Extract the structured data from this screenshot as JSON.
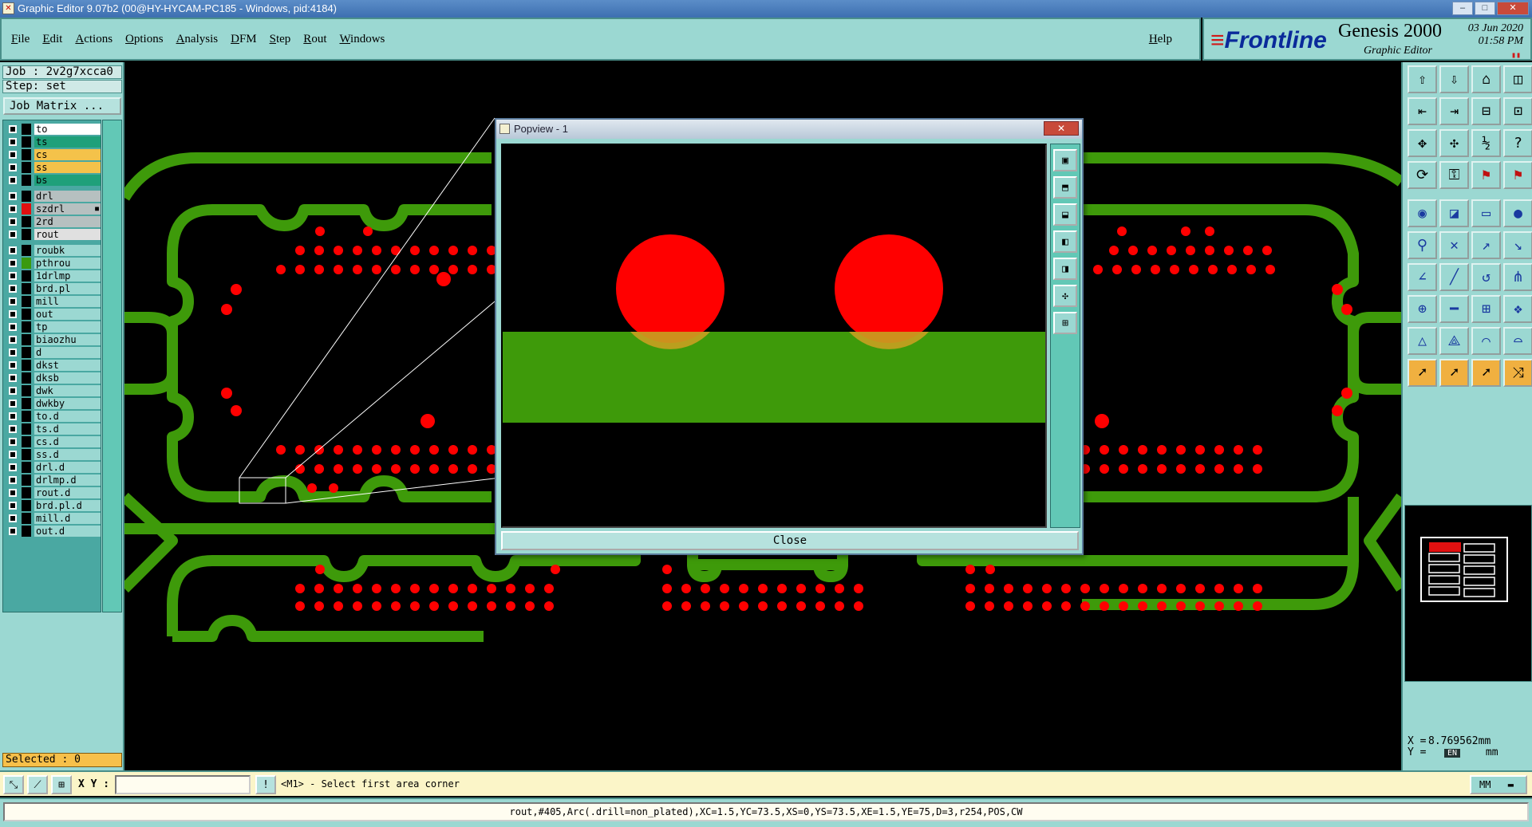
{
  "window": {
    "title": "Graphic Editor 9.07b2 (00@HY-HYCAM-PC185 - Windows, pid:4184)",
    "min": "–",
    "max": "□",
    "close": "✕"
  },
  "menu": [
    "File",
    "Edit",
    "Actions",
    "Options",
    "Analysis",
    "DFM",
    "Step",
    "Rout",
    "Windows"
  ],
  "help": "Help",
  "brand": {
    "logo": "Frontline",
    "product": "Genesis 2000",
    "subtitle": "Graphic Editor",
    "date": "03 Jun 2020",
    "time": "01:58 PM"
  },
  "job": {
    "job_line": "Job : 2v2g7xcca0",
    "step_line": "Step: set",
    "matrix_button": "Job Matrix ..."
  },
  "layers": [
    {
      "name": "to",
      "color": "#ffffff",
      "swatch": "#000000"
    },
    {
      "name": "ts",
      "color": "#1fa07a",
      "swatch": "#000000"
    },
    {
      "name": "cs",
      "color": "#f4c24a",
      "swatch": "#000000"
    },
    {
      "name": "ss",
      "color": "#f4c24a",
      "swatch": "#000000"
    },
    {
      "name": "bs",
      "color": "#1fa07a",
      "swatch": "#000000"
    },
    {
      "name": "drl",
      "color": "#b6c0c0",
      "swatch": "#000000"
    },
    {
      "name": "szdrl",
      "color": "#b6c0c0",
      "swatch": "#e01010",
      "marker": "■"
    },
    {
      "name": "2rd",
      "color": "#b6c0c0",
      "swatch": "#000000"
    },
    {
      "name": "rout",
      "color": "#e0e0e0",
      "swatch": "#000000"
    },
    {
      "name": "roubk",
      "color": "#9bd8d2",
      "swatch": "#000000"
    },
    {
      "name": "pthrou",
      "color": "#9bd8d2",
      "swatch": "#3a9a10"
    },
    {
      "name": "1drlmp",
      "color": "#9bd8d2",
      "swatch": "#000000"
    },
    {
      "name": "brd.pl",
      "color": "#9bd8d2",
      "swatch": "#000000"
    },
    {
      "name": "mill",
      "color": "#9bd8d2",
      "swatch": "#000000"
    },
    {
      "name": "out",
      "color": "#9bd8d2",
      "swatch": "#000000"
    },
    {
      "name": "tp",
      "color": "#9bd8d2",
      "swatch": "#000000"
    },
    {
      "name": "biaozhu",
      "color": "#9bd8d2",
      "swatch": "#000000"
    },
    {
      "name": "d",
      "color": "#9bd8d2",
      "swatch": "#000000"
    },
    {
      "name": "dkst",
      "color": "#9bd8d2",
      "swatch": "#000000"
    },
    {
      "name": "dksb",
      "color": "#9bd8d2",
      "swatch": "#000000"
    },
    {
      "name": "dwk",
      "color": "#9bd8d2",
      "swatch": "#000000"
    },
    {
      "name": "dwkby",
      "color": "#9bd8d2",
      "swatch": "#000000"
    },
    {
      "name": "to.d",
      "color": "#9bd8d2",
      "swatch": "#000000"
    },
    {
      "name": "ts.d",
      "color": "#9bd8d2",
      "swatch": "#000000"
    },
    {
      "name": "cs.d",
      "color": "#9bd8d2",
      "swatch": "#000000"
    },
    {
      "name": "ss.d",
      "color": "#9bd8d2",
      "swatch": "#000000"
    },
    {
      "name": "drl.d",
      "color": "#9bd8d2",
      "swatch": "#000000"
    },
    {
      "name": "drlmp.d",
      "color": "#9bd8d2",
      "swatch": "#000000"
    },
    {
      "name": "rout.d",
      "color": "#9bd8d2",
      "swatch": "#000000"
    },
    {
      "name": "brd.pl.d",
      "color": "#9bd8d2",
      "swatch": "#000000"
    },
    {
      "name": "mill.d",
      "color": "#9bd8d2",
      "swatch": "#000000"
    },
    {
      "name": "out.d",
      "color": "#9bd8d2",
      "swatch": "#000000"
    }
  ],
  "selected": "Selected : 0",
  "popview": {
    "title": "Popview - 1",
    "close_label": "Close"
  },
  "toolbar_icons": [
    "open-step-icon",
    "save-icon",
    "home-icon",
    "layout-icon",
    "import-icon",
    "export-icon",
    "split-icon",
    "compare-icon",
    "fit-icon",
    "center-icon",
    "scale-icon",
    "query-icon",
    "helicopter-icon",
    "key-icon",
    "snap-red-icon",
    "snap-red2-icon",
    "measure-icon",
    "clip-icon",
    "ruler-icon",
    "pad-icon",
    "connect-icon",
    "cross-icon",
    "move-icon",
    "resize-icon",
    "line-icon",
    "slash-icon",
    "arc-icon",
    "pattern-icon",
    "add-pad-icon",
    "delete-line-icon",
    "box-icon",
    "route-icon",
    "triangle-icon",
    "polygon-icon",
    "arch-icon",
    "arch2-icon",
    "select-icon",
    "select-box-icon",
    "select-lasso-icon",
    "select-multi-icon"
  ],
  "coords": {
    "x_label": "X =",
    "x_value": "8.769562mm",
    "y_label": "Y =",
    "y_value": "mm",
    "ime": "EN"
  },
  "cmd": {
    "xy_label": "X Y :",
    "xy_value": "",
    "prompt": "<M1> - Select first area corner",
    "unit": "MM"
  },
  "status": "rout,#405,Arc(.drill=non_plated),XC=1.5,YC=73.5,XS=0,YS=73.5,XE=1.5,YE=75,D=3,r254,POS,CW",
  "colors": {
    "trace": "#3e9a0a",
    "pad": "#ff0000",
    "panel": "#9bd8d2",
    "accent_orange": "#f0b040"
  }
}
